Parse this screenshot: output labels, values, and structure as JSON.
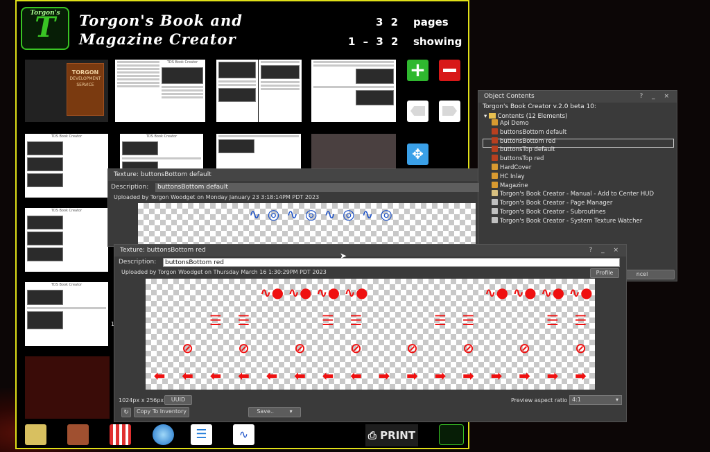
{
  "hud": {
    "logo_letter": "T",
    "logo_top": "Torgon's",
    "title": "Torgon's Book and Magazine Creator",
    "pages_count": "3 2",
    "pages_label": "pages",
    "range": "1 – 3 2",
    "range_label": "showing",
    "cover_line1": "TORGON",
    "cover_line2": "DEVELOPMENT SERVICE",
    "print_label": "PRINT",
    "thumbs": [
      {
        "heading": "TDS Book Creator"
      },
      {
        "heading": "TDS Book Creator"
      },
      {
        "heading": "TDS Book Creator"
      },
      {
        "heading": "TDS Book Creator"
      },
      {
        "heading": "TDS Book Creator"
      }
    ]
  },
  "object_contents": {
    "title": "Object Contents",
    "window_controls": "? _ ×",
    "object_name": "Torgon's Book Creator v.2.0 beta 10:",
    "folder": "Contents (12 Elements)",
    "items": [
      {
        "label": "Api Demo",
        "icon": "box-icon",
        "color": "#d89a30"
      },
      {
        "label": "buttonsBottom default",
        "icon": "texture-icon",
        "color": "#b84020"
      },
      {
        "label": "buttonsBottom red",
        "icon": "texture-icon",
        "color": "#b84020"
      },
      {
        "label": "buttonsTop default",
        "icon": "texture-icon",
        "color": "#b84020"
      },
      {
        "label": "buttonsTop red",
        "icon": "texture-icon",
        "color": "#b84020"
      },
      {
        "label": "HardCover",
        "icon": "box-icon",
        "color": "#d89a30"
      },
      {
        "label": "HC Inlay",
        "icon": "box-icon",
        "color": "#d89a30"
      },
      {
        "label": "Magazine",
        "icon": "box-icon",
        "color": "#d89a30"
      },
      {
        "label": "Torgon's Book Creator - Manual - Add to Center HUD",
        "icon": "notecard-icon",
        "color": "#d8c080"
      },
      {
        "label": "Torgon's Book Creator - Page Manager",
        "icon": "script-icon",
        "color": "#c0c0c0"
      },
      {
        "label": "Torgon's Book Creator - Subroutines",
        "icon": "script-icon",
        "color": "#c0c0c0"
      },
      {
        "label": "Torgon's Book Creator - System Texture Watcher",
        "icon": "script-icon",
        "color": "#c0c0c0"
      }
    ],
    "cancel_label": "ncel"
  },
  "tex1": {
    "title": "Texture: buttonsBottom default",
    "desc_label": "Description:",
    "desc_value": "buttonsBottom default",
    "uploaded": "Uploaded by Torgon Woodget on Monday January 23 3:18:14PM PDT 2023",
    "side_digit": "1"
  },
  "tex2": {
    "title": "Texture: buttonsBottom red",
    "window_controls": "? _ ×",
    "desc_label": "Description:",
    "desc_value": "buttonsBottom red",
    "uploaded": "Uploaded by Torgon Woodget on Thursday March 16 1:30:29PM PDT 2023",
    "profile_label": "Profile",
    "dimensions": "1024px x 256px",
    "uuid_label": "UUID",
    "copy_label": "Copy To Inventory",
    "save_label": "Save..",
    "aspect_label": "Preview aspect ratio",
    "aspect_value": "4:1"
  },
  "colors": {
    "accent_yellow": "#e0e018",
    "red_icon": "#ef1010",
    "green": "#39c424"
  }
}
